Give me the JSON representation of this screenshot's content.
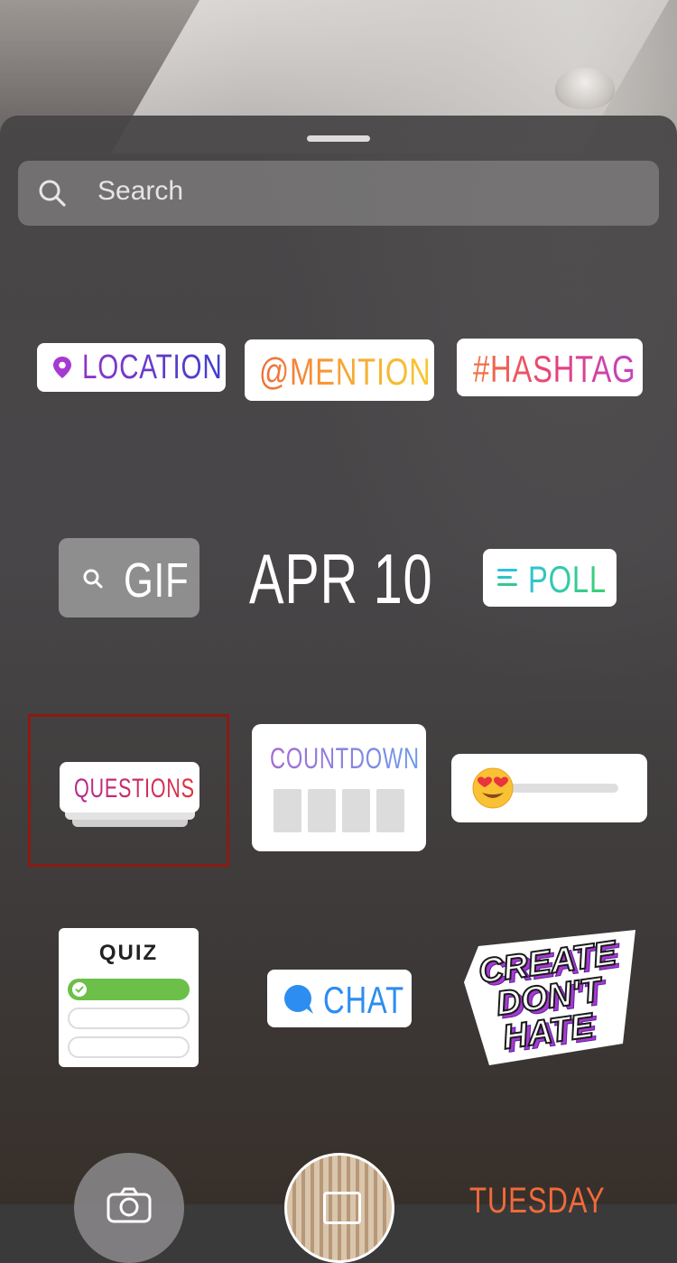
{
  "search": {
    "placeholder": "Search"
  },
  "stickers": {
    "location": "LOCATION",
    "mention": "@MENTION",
    "hashtag": "#HASHTAG",
    "gif": "GIF",
    "date": "APR 10",
    "poll": "POLL",
    "questions": "QUESTIONS",
    "countdown": "COUNTDOWN",
    "quiz": "QUIZ",
    "chat": "CHAT",
    "create_line1": "CREATE",
    "create_line2": "DON'T",
    "create_line3": "HATE",
    "tuesday": "TUESDAY"
  },
  "icons": {
    "search": "search-icon",
    "location": "location-pin-icon",
    "gif_search": "search-icon",
    "poll": "poll-lines-icon",
    "emoji": "heart-eyes-emoji-icon",
    "quiz_check": "checkmark-icon",
    "chat": "chat-bubble-icon",
    "camera": "camera-icon"
  },
  "colors": {
    "highlight_border": "#8b1a12",
    "chat_text": "#2d8df0",
    "quiz_correct": "#6cc04a",
    "tuesday": "#f06a3c"
  },
  "slider": {
    "level": 0.12
  }
}
